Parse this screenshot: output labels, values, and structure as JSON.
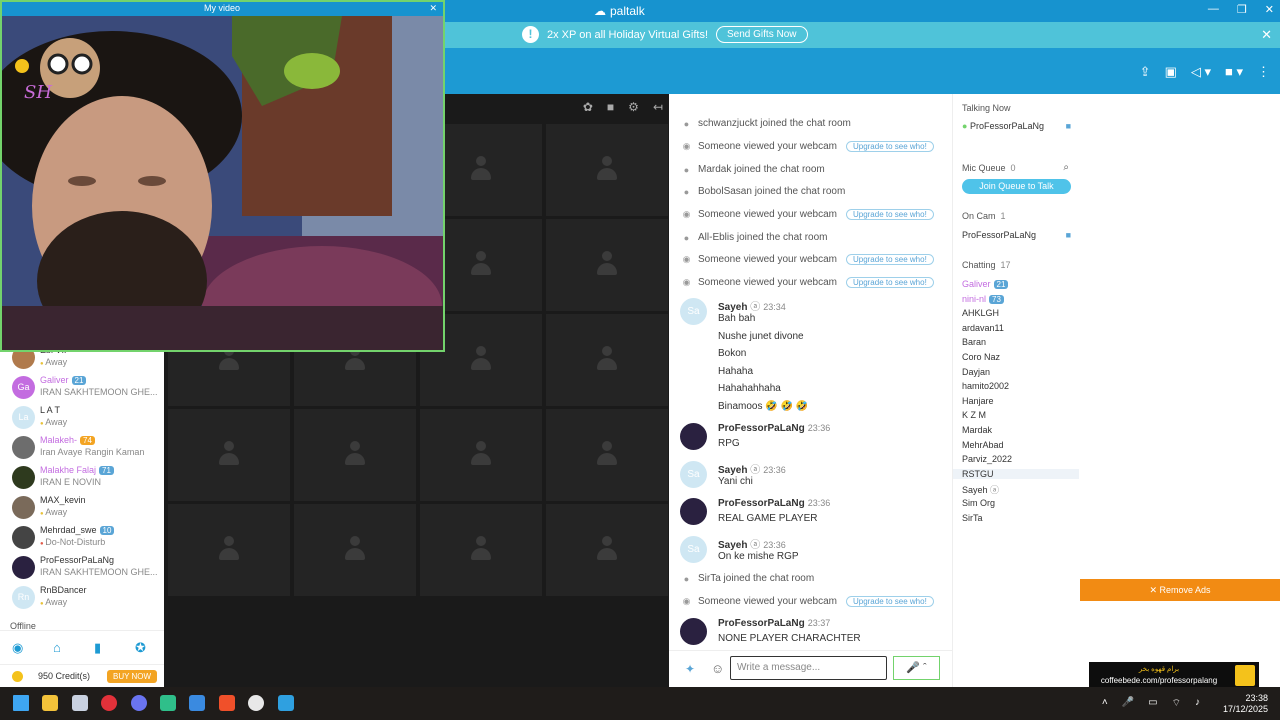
{
  "window": {
    "app_name": "paltalk",
    "minimize": "—",
    "restore": "❐",
    "close": "✕"
  },
  "promo": {
    "info": "!",
    "text": "2x XP on all Holiday Virtual Gifts!",
    "button": "Send Gifts Now",
    "close": "✕"
  },
  "toolbar": {
    "icons": [
      "share-icon",
      "gift-icon",
      "megaphone-icon",
      "video-camera-icon",
      "more-icon"
    ]
  },
  "my_video": {
    "title": "My video",
    "close": "✕",
    "watermark": "SH"
  },
  "grid_bar": {
    "icons": [
      "paw-icon",
      "camera-icon",
      "settings-icon",
      "collapse-icon"
    ]
  },
  "left_users": [
    {
      "initials": "",
      "name": "Ebi VIP",
      "status": "Away",
      "badge": "",
      "color": "#b07a4c",
      "status_dot": "#e8c23a"
    },
    {
      "initials": "Ga",
      "name": "Galiver",
      "status": "IRAN SAKHTEMOON GHE...",
      "badge": "21",
      "color": "#c36ce0",
      "status_dot": ""
    },
    {
      "initials": "La",
      "name": "L A T",
      "status": "Away",
      "badge": "",
      "color": "#cfe7f3",
      "status_dot": "#e8c23a"
    },
    {
      "initials": "",
      "name": "Malakeh-",
      "status": "Iran Avaye Rangin Kaman",
      "badge": "74",
      "color": "#6d6d6d",
      "status_dot": ""
    },
    {
      "initials": "",
      "name": "Malakhe Falaj",
      "status": "IRAN E NOVIN",
      "badge": "71",
      "color": "#2e3a1e",
      "status_dot": ""
    },
    {
      "initials": "",
      "name": "MAX_kevin",
      "status": "Away",
      "badge": "",
      "color": "#7a6a5a",
      "status_dot": "#e8c23a"
    },
    {
      "initials": "",
      "name": "Mehrdad_swe",
      "status": "Do-Not-Disturb",
      "badge": "10",
      "color": "#444",
      "status_dot": "#e25c4a"
    },
    {
      "initials": "",
      "name": "ProFessorPaLaNg",
      "status": "IRAN SAKHTEMOON GHE...",
      "badge": "",
      "color": "#2a2140",
      "status_dot": ""
    },
    {
      "initials": "Rn",
      "name": "RnBDancer",
      "status": "Away",
      "badge": "",
      "color": "#cfe7f3",
      "status_dot": "#e8c23a"
    }
  ],
  "offline_label": "Offline",
  "left_nav": [
    "compass-icon",
    "home-icon",
    "stats-icon",
    "support-icon"
  ],
  "credits": {
    "text": "950 Credit(s)",
    "buy": "BUY NOW"
  },
  "chat": {
    "system": [
      {
        "icon": "person-icon",
        "text": "schwanzjuckt joined the chat room",
        "upgrade": ""
      },
      {
        "icon": "eye-icon",
        "text": "Someone viewed your webcam",
        "upgrade": "Upgrade to see who!"
      },
      {
        "icon": "person-icon",
        "text": "Mardak joined the chat room",
        "upgrade": ""
      },
      {
        "icon": "person-icon",
        "text": "BobolSasan joined the chat room",
        "upgrade": ""
      },
      {
        "icon": "eye-icon",
        "text": "Someone viewed your webcam",
        "upgrade": "Upgrade to see who!"
      },
      {
        "icon": "person-icon",
        "text": "All-Eblis joined the chat room",
        "upgrade": ""
      },
      {
        "icon": "eye-icon",
        "text": "Someone viewed your webcam",
        "upgrade": "Upgrade to see who!"
      },
      {
        "icon": "eye-icon",
        "text": "Someone viewed your webcam",
        "upgrade": "Upgrade to see who!"
      }
    ],
    "messages": [
      {
        "initials": "Sa",
        "name": "Sayeh",
        "time": "23:34",
        "lines": [
          "Bah bah",
          "Nushe junet divone",
          "Bokon",
          "Hahaha",
          "Hahahahhaha",
          "Binamoos 🤣 🤣 🤣"
        ]
      },
      {
        "initials": "",
        "name": "ProFessorPaLaNg",
        "time": "23:36",
        "lines": [
          "RPG"
        ]
      },
      {
        "initials": "Sa",
        "name": "Sayeh",
        "time": "23:36",
        "lines": [
          "Yani chi"
        ]
      },
      {
        "initials": "",
        "name": "ProFessorPaLaNg",
        "time": "23:36",
        "lines": [
          "REAL GAME PLAYER"
        ]
      },
      {
        "initials": "Sa",
        "name": "Sayeh",
        "time": "23:36",
        "lines": [
          "On ke mishe RGP"
        ]
      }
    ],
    "system2": [
      {
        "icon": "person-icon",
        "text": "SirTa joined the chat room",
        "upgrade": ""
      },
      {
        "icon": "eye-icon",
        "text": "Someone viewed your webcam",
        "upgrade": "Upgrade to see who!"
      }
    ],
    "last_message": {
      "initials": "",
      "name": "ProFessorPaLaNg",
      "time": "23:37",
      "lines": [
        "NONE PLAYER CHARACHTER"
      ]
    },
    "input_placeholder": "Write a message..."
  },
  "right_panel": {
    "talking_label": "Talking Now",
    "talking_user": "ProFessorPaLaNg",
    "mic_queue_label": "Mic Queue",
    "mic_queue_count": "0",
    "join_queue": "Join Queue to Talk",
    "on_cam_label": "On Cam",
    "on_cam_count": "1",
    "on_cam_user": "ProFessorPaLaNg",
    "chatting_label": "Chatting",
    "chatting_count": "17",
    "users": [
      {
        "name": "Galiver",
        "badge": "21",
        "color": "#c36ce0"
      },
      {
        "name": "nini-nl",
        "badge": "73",
        "color": "#c36ce0"
      },
      {
        "name": "AHKLGH",
        "badge": "",
        "color": "#333"
      },
      {
        "name": "ardavan11",
        "badge": "",
        "color": "#333"
      },
      {
        "name": "Baran",
        "badge": "",
        "color": "#333"
      },
      {
        "name": "Coro Naz",
        "badge": "",
        "color": "#333"
      },
      {
        "name": "Dayjan",
        "badge": "",
        "color": "#333"
      },
      {
        "name": "hamito2002",
        "badge": "",
        "color": "#333"
      },
      {
        "name": "Hanjare",
        "badge": "",
        "color": "#333"
      },
      {
        "name": "K Z M",
        "badge": "",
        "color": "#333"
      },
      {
        "name": "Mardak",
        "badge": "",
        "color": "#333"
      },
      {
        "name": "MehrAbad",
        "badge": "",
        "color": "#333"
      },
      {
        "name": "Parviz_2022",
        "badge": "",
        "color": "#333"
      },
      {
        "name": "RSTGU",
        "badge": "",
        "color": "#333"
      },
      {
        "name": "Sayeh",
        "badge": "",
        "color": "#333"
      },
      {
        "name": "Sim Org",
        "badge": "",
        "color": "#333"
      },
      {
        "name": "SirTa",
        "badge": "",
        "color": "#333"
      }
    ]
  },
  "ads": {
    "remove": "✕ Remove Ads",
    "banner_top": "برام قهوه بخر",
    "banner_url": "coffeebede.com/professorpalang"
  },
  "taskbar": {
    "time": "23:38",
    "date": "17/12/2025",
    "apps": [
      "windows-start-icon",
      "file-explorer-icon",
      "steam-icon",
      "opera-icon",
      "discord-icon",
      "app-green-icon",
      "app-blue-icon",
      "brave-icon",
      "app-white-icon",
      "paltalk-icon"
    ]
  }
}
